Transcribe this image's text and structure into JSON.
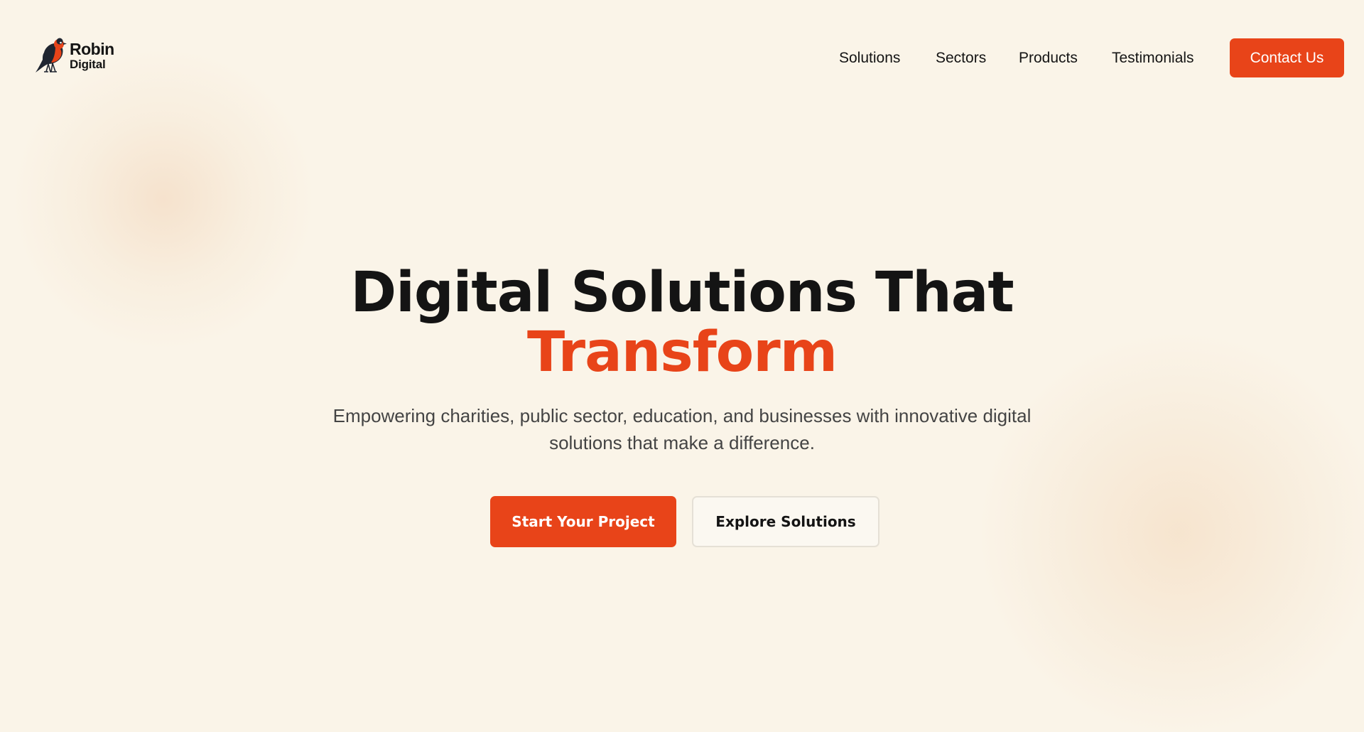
{
  "theme": {
    "accent": "#e84419",
    "background": "#faf4e8",
    "text": "#141414"
  },
  "logo": {
    "icon": "robin-bird-icon",
    "word1": "Robin",
    "word2": "Digital"
  },
  "nav": {
    "items": [
      {
        "label": "Solutions"
      },
      {
        "label": "Sectors"
      },
      {
        "label": "Products"
      },
      {
        "label": "Testimonials"
      }
    ],
    "contact_label": "Contact Us"
  },
  "hero": {
    "title_line1": "Digital Solutions That",
    "title_line2": "Transform",
    "subtitle": "Empowering charities, public sector, education, and businesses with innovative digital solutions that make a difference.",
    "primary_cta": "Start Your Project",
    "secondary_cta": "Explore Solutions"
  }
}
